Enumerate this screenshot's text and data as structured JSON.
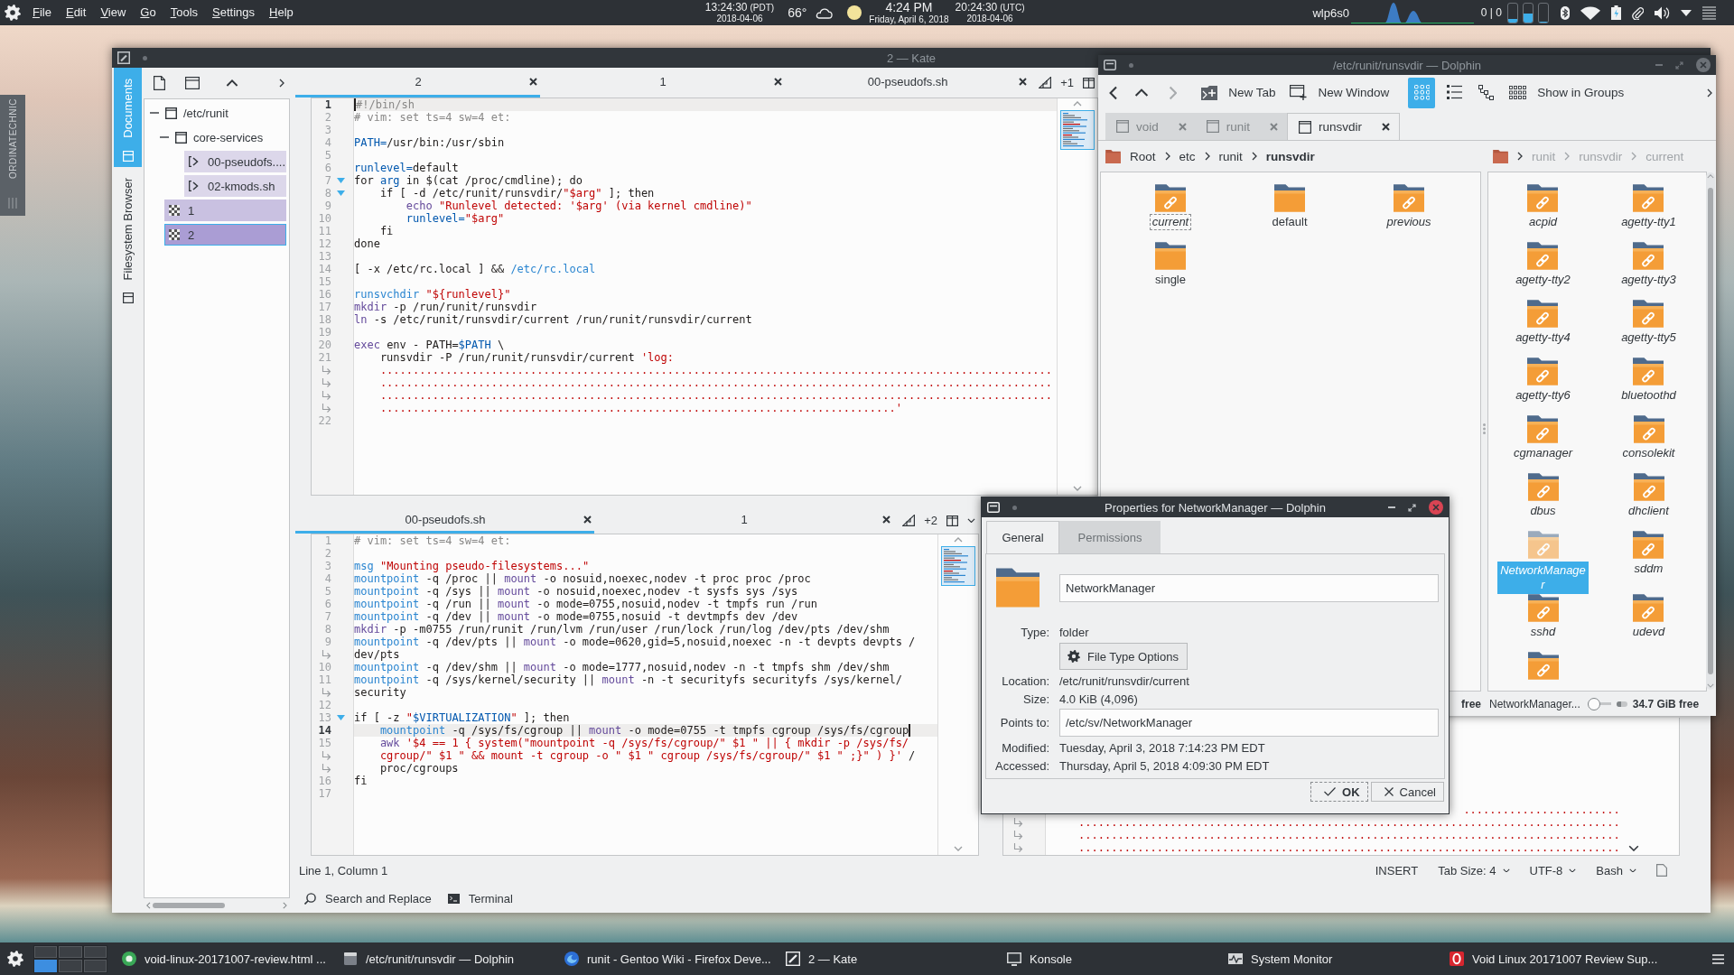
{
  "top_panel": {
    "menu": [
      "File",
      "Edit",
      "View",
      "Go",
      "Tools",
      "Settings",
      "Help"
    ],
    "local_clock": {
      "time": "13:24:30",
      "zone": "(PDT)",
      "date": "2018-04-06"
    },
    "temperature": "66°",
    "clock": {
      "time": "4:24 PM",
      "date": "Friday, April 6, 2018"
    },
    "utc_clock": {
      "time": "20:24:30",
      "zone": "(UTC)",
      "date": "2018-04-06"
    },
    "network_interface": "wlp6s0",
    "network_rate": "0 | 0",
    "load_meters": [
      {
        "level": 0.15
      },
      {
        "level": 0.45
      },
      {
        "level": 0
      }
    ]
  },
  "side_panel": {
    "label": "ORDINATECHNIC"
  },
  "kate": {
    "title": "2 — Kate",
    "side_tabs": [
      {
        "label": "Documents",
        "selected": true
      },
      {
        "label": "Filesystem Browser",
        "selected": false
      }
    ],
    "documents": [
      {
        "label": "/etc/runit",
        "kind": "folder",
        "expanded": true,
        "selected": false,
        "children": [
          {
            "label": "core-services",
            "kind": "folder",
            "expanded": true,
            "selected": false,
            "children": [
              {
                "label": "00-pseudofs....",
                "kind": "script",
                "selected": false,
                "color": "#dcd7ea"
              },
              {
                "label": "02-kmods.sh",
                "kind": "script",
                "selected": false,
                "color": "#dcd7ea"
              }
            ]
          }
        ]
      },
      {
        "label": "1",
        "kind": "untitled",
        "selected": false,
        "color": "#c9c1e1"
      },
      {
        "label": "2",
        "kind": "untitled",
        "selected": true,
        "color": "#aa9dd4"
      }
    ],
    "views": [
      {
        "tabs": [
          {
            "label": "2",
            "selected": true
          },
          {
            "label": "1",
            "selected": false
          },
          {
            "label": "00-pseudofs.sh",
            "selected": false
          }
        ],
        "more": "+1",
        "cursor_at_end": false,
        "lines": [
          {
            "number": "1",
            "current": true,
            "fold": false,
            "segments": [
              {
                "kind": "comment",
                "text": "#!/bin/sh"
              }
            ]
          },
          {
            "number": "2",
            "current": false,
            "fold": false,
            "segments": [
              {
                "kind": "comment",
                "text": "# vim: set ts=4 sw=4 et:"
              }
            ]
          },
          {
            "number": "3",
            "current": false,
            "fold": false
          },
          {
            "number": "4",
            "current": false,
            "fold": false,
            "segments": [
              {
                "kind": "variable",
                "text": "PATH="
              },
              {
                "kind": "plain",
                "text": "/usr/bin:/usr/sbin"
              }
            ]
          },
          {
            "number": "5",
            "current": false,
            "fold": false
          },
          {
            "number": "6",
            "current": false,
            "fold": false,
            "segments": [
              {
                "kind": "variable",
                "text": "runlevel="
              },
              {
                "kind": "plain",
                "text": "default"
              }
            ]
          },
          {
            "number": "7",
            "current": false,
            "fold": true,
            "segments": [
              {
                "kind": "plain",
                "text": "for "
              },
              {
                "kind": "variable",
                "text": "arg"
              },
              {
                "kind": "plain",
                "text": " in $(cat /proc/cmdline); do"
              }
            ]
          },
          {
            "number": "8",
            "current": false,
            "fold": true,
            "segments": [
              {
                "kind": "plain",
                "text": "    if [ -d /etc/runit/runsvdir/"
              },
              {
                "kind": "string",
                "text": "\"$arg\""
              },
              {
                "kind": "plain",
                "text": " ]; then"
              }
            ]
          },
          {
            "number": "9",
            "current": false,
            "fold": false,
            "segments": [
              {
                "kind": "builtin",
                "text": "        echo"
              },
              {
                "kind": "string",
                "text": " \"Runlevel detected: '$arg' (via kernel cmdline)\""
              }
            ]
          },
          {
            "number": "10",
            "current": false,
            "fold": false,
            "segments": [
              {
                "kind": "variable",
                "text": "        runlevel="
              },
              {
                "kind": "string",
                "text": "\"$arg\""
              }
            ]
          },
          {
            "number": "11",
            "current": false,
            "fold": false,
            "segments": [
              {
                "kind": "plain",
                "text": "    fi"
              }
            ]
          },
          {
            "number": "12",
            "current": false,
            "fold": false,
            "segments": [
              {
                "kind": "plain",
                "text": "done"
              }
            ]
          },
          {
            "number": "13",
            "current": false,
            "fold": false
          },
          {
            "number": "14",
            "current": false,
            "fold": false,
            "segments": [
              {
                "kind": "plain",
                "text": "[ -x /etc/rc.local ] && "
              },
              {
                "kind": "command",
                "text": "/etc/rc.local"
              }
            ]
          },
          {
            "number": "15",
            "current": false,
            "fold": false
          },
          {
            "number": "16",
            "current": false,
            "fold": false,
            "segments": [
              {
                "kind": "command",
                "text": "runsvchdir"
              },
              {
                "kind": "string",
                "text": " \"${runlevel}\""
              }
            ]
          },
          {
            "number": "17",
            "current": false,
            "fold": false,
            "segments": [
              {
                "kind": "builtin",
                "text": "mkdir"
              },
              {
                "kind": "plain",
                "text": " -p /run/runit/runsvdir"
              }
            ]
          },
          {
            "number": "18",
            "current": false,
            "fold": false,
            "segments": [
              {
                "kind": "builtin",
                "text": "ln"
              },
              {
                "kind": "plain",
                "text": " -s /etc/runit/runsvdir/current /run/runit/runsvdir/current"
              }
            ]
          },
          {
            "number": "19",
            "current": false,
            "fold": false
          },
          {
            "number": "20",
            "current": false,
            "fold": false,
            "segments": [
              {
                "kind": "builtin",
                "text": "exec"
              },
              {
                "kind": "plain",
                "text": " env - PATH="
              },
              {
                "kind": "variable",
                "text": "$PATH"
              },
              {
                "kind": "plain",
                "text": " \\"
              }
            ]
          },
          {
            "number": "21",
            "current": false,
            "fold": false,
            "segments": [
              {
                "kind": "plain",
                "text": "    runsvdir -P /run/runit/runsvdir/current "
              },
              {
                "kind": "string",
                "text": "'log:"
              }
            ],
            "wraps": [
              {
                "segments": [
                  {
                    "kind": "string",
                    "text": "....................................................................................................................................................................................................................................................................................................................................................................................................'"
                  }
                ]
              }
            ]
          },
          {
            "number": "22",
            "current": false,
            "fold": false
          }
        ]
      },
      {
        "tabs": [
          {
            "label": "00-pseudofs.sh",
            "selected": true
          },
          {
            "label": "1",
            "selected": false
          }
        ],
        "more": "+2",
        "cursor_at_end": true,
        "lines": [
          {
            "number": "1",
            "current": false,
            "fold": false,
            "segments": [
              {
                "kind": "comment",
                "text": "# vim: set ts=4 sw=4 et:"
              }
            ]
          },
          {
            "number": "2",
            "current": false,
            "fold": false
          },
          {
            "number": "3",
            "current": false,
            "fold": false,
            "segments": [
              {
                "kind": "command",
                "text": "msg"
              },
              {
                "kind": "string",
                "text": " \"Mounting pseudo-filesystems...\""
              }
            ]
          },
          {
            "number": "4",
            "current": false,
            "fold": false,
            "segments": [
              {
                "kind": "command",
                "text": "mountpoint"
              },
              {
                "kind": "plain",
                "text": " -q /proc || "
              },
              {
                "kind": "builtin",
                "text": "mount"
              },
              {
                "kind": "plain",
                "text": " -o nosuid,noexec,nodev -t proc proc /proc"
              }
            ]
          },
          {
            "number": "5",
            "current": false,
            "fold": false,
            "segments": [
              {
                "kind": "command",
                "text": "mountpoint"
              },
              {
                "kind": "plain",
                "text": " -q /sys || "
              },
              {
                "kind": "builtin",
                "text": "mount"
              },
              {
                "kind": "plain",
                "text": " -o nosuid,noexec,nodev -t sysfs sys /sys"
              }
            ]
          },
          {
            "number": "6",
            "current": false,
            "fold": false,
            "segments": [
              {
                "kind": "command",
                "text": "mountpoint"
              },
              {
                "kind": "plain",
                "text": " -q /run || "
              },
              {
                "kind": "builtin",
                "text": "mount"
              },
              {
                "kind": "plain",
                "text": " -o mode=0755,nosuid,nodev -t tmpfs run /run"
              }
            ]
          },
          {
            "number": "7",
            "current": false,
            "fold": false,
            "segments": [
              {
                "kind": "command",
                "text": "mountpoint"
              },
              {
                "kind": "plain",
                "text": " -q /dev || "
              },
              {
                "kind": "builtin",
                "text": "mount"
              },
              {
                "kind": "plain",
                "text": " -o mode=0755,nosuid -t devtmpfs dev /dev"
              }
            ]
          },
          {
            "number": "8",
            "current": false,
            "fold": false,
            "segments": [
              {
                "kind": "builtin",
                "text": "mkdir"
              },
              {
                "kind": "plain",
                "text": " -p -m0755 /run/runit /run/lvm /run/user /run/lock /run/log /dev/pts /dev/shm"
              }
            ]
          },
          {
            "number": "9",
            "current": false,
            "fold": false,
            "segments": [
              {
                "kind": "command",
                "text": "mountpoint"
              },
              {
                "kind": "plain",
                "text": " -q /dev/pts || "
              },
              {
                "kind": "builtin",
                "text": "mount"
              },
              {
                "kind": "plain",
                "text": " -o mode=0620,gid=5,nosuid,noexec -n -t devpts devpts /"
              }
            ],
            "wraps": [
              {
                "segments": [
                  {
                    "kind": "plain",
                    "text": "dev/pts"
                  }
                ]
              }
            ]
          },
          {
            "number": "10",
            "current": false,
            "fold": false,
            "segments": [
              {
                "kind": "command",
                "text": "mountpoint"
              },
              {
                "kind": "plain",
                "text": " -q /dev/shm || "
              },
              {
                "kind": "builtin",
                "text": "mount"
              },
              {
                "kind": "plain",
                "text": " -o mode=1777,nosuid,nodev -n -t tmpfs shm /dev/shm"
              }
            ]
          },
          {
            "number": "11",
            "current": false,
            "fold": false,
            "segments": [
              {
                "kind": "command",
                "text": "mountpoint"
              },
              {
                "kind": "plain",
                "text": " -q /sys/kernel/security || "
              },
              {
                "kind": "builtin",
                "text": "mount"
              },
              {
                "kind": "plain",
                "text": " -n -t securityfs securityfs /sys/kernel/"
              }
            ],
            "wraps": [
              {
                "segments": [
                  {
                    "kind": "plain",
                    "text": "security"
                  }
                ]
              }
            ]
          },
          {
            "number": "12",
            "current": false,
            "fold": false
          },
          {
            "number": "13",
            "current": false,
            "fold": true,
            "segments": [
              {
                "kind": "plain",
                "text": "if [ -z "
              },
              {
                "kind": "string",
                "text": "\""
              },
              {
                "kind": "variable",
                "text": "$VIRTUALIZATION"
              },
              {
                "kind": "string",
                "text": "\""
              },
              {
                "kind": "plain",
                "text": " ]; then"
              }
            ]
          },
          {
            "number": "14",
            "current": true,
            "fold": false,
            "segments": [
              {
                "kind": "command",
                "text": "    mountpoint"
              },
              {
                "kind": "plain",
                "text": " -q /sys/fs/cgroup || "
              },
              {
                "kind": "builtin",
                "text": "mount"
              },
              {
                "kind": "plain",
                "text": " -o mode=0755 -t tmpfs cgroup /sys/fs/cgroup"
              }
            ]
          },
          {
            "number": "15",
            "current": false,
            "fold": false,
            "segments": [
              {
                "kind": "builtin",
                "text": "    awk"
              },
              {
                "kind": "string",
                "text": " '$4 == 1 { system(\"mountpoint -q /sys/fs/cgroup/\" $1 \" || { mkdir -p /sys/fs/"
              }
            ],
            "wraps": [
              {
                "segments": [
                  {
                    "kind": "string",
                    "text": "cgroup/\" $1 \" && mount -t cgroup -o \" $1 \" cgroup /sys/fs/cgroup/\" $1 \" ;}\" ) }'"
                  },
                  {
                    "kind": "plain",
                    "text": " /"
                  }
                ]
              },
              {
                "segments": [
                  {
                    "kind": "plain",
                    "text": "proc/cgroups"
                  }
                ]
              }
            ]
          },
          {
            "number": "16",
            "current": false,
            "fold": false,
            "segments": [
              {
                "kind": "plain",
                "text": "fi"
              }
            ]
          },
          {
            "number": "17",
            "current": false,
            "fold": false
          }
        ]
      }
    ],
    "third_view": {
      "wrap_rows": [
        {
          "segments": [
            {
              "kind": "string",
              "text": "........................"
            }
          ]
        },
        {
          "segments": [
            {
              "kind": "string",
              "text": "..................................................................................."
            }
          ]
        },
        {
          "segments": [
            {
              "kind": "string",
              "text": "..................................................................................."
            }
          ]
        },
        {
          "segments": [
            {
              "kind": "string",
              "text": "..................................................................................."
            }
          ]
        }
      ]
    },
    "status": {
      "position": "Line 1, Column 1",
      "mode": "INSERT",
      "menus": [
        "Tab Size: 4",
        "UTF-8",
        "Bash"
      ]
    },
    "tools": [
      {
        "label": "Search and Replace",
        "kind": "search"
      },
      {
        "label": "Terminal",
        "kind": "terminal"
      }
    ]
  },
  "dolphin": {
    "title": "/etc/runit/runsvdir — Dolphin",
    "toolbar": {
      "new_tab": "New Tab",
      "new_window": "New Window",
      "view_modes": [
        {
          "kind": "icons",
          "selected": true
        },
        {
          "kind": "compact",
          "selected": false
        },
        {
          "kind": "details",
          "selected": false
        }
      ],
      "groups": "Show in Groups"
    },
    "tabs": [
      {
        "label": "void",
        "selected": false
      },
      {
        "label": "runit",
        "selected": false
      },
      {
        "label": "runsvdir",
        "selected": true
      }
    ],
    "panes": [
      {
        "active": true,
        "collapsed": false,
        "breadcrumb": [
          "Root",
          "etc",
          "runit",
          "runsvdir"
        ],
        "items": [
          {
            "label": "current",
            "symlink": true,
            "selected": false,
            "focused": true
          },
          {
            "label": "default",
            "symlink": false,
            "selected": false,
            "focused": false
          },
          {
            "label": "previous",
            "symlink": true,
            "selected": false,
            "focused": false
          },
          {
            "label": "single",
            "symlink": false,
            "selected": false,
            "focused": false
          }
        ],
        "status": {
          "free_space": "free"
        }
      },
      {
        "active": false,
        "collapsed": true,
        "breadcrumb": [
          "runit",
          "runsvdir",
          "current"
        ],
        "items": [
          {
            "label": "acpid",
            "symlink": true,
            "selected": false,
            "focused": false
          },
          {
            "label": "agetty-tty1",
            "symlink": true,
            "selected": false,
            "focused": false
          },
          {
            "label": "agetty-tty2",
            "symlink": true,
            "selected": false,
            "focused": false
          },
          {
            "label": "agetty-tty3",
            "symlink": true,
            "selected": false,
            "focused": false
          },
          {
            "label": "agetty-tty4",
            "symlink": true,
            "selected": false,
            "focused": false
          },
          {
            "label": "agetty-tty5",
            "symlink": true,
            "selected": false,
            "focused": false
          },
          {
            "label": "agetty-tty6",
            "symlink": true,
            "selected": false,
            "focused": false
          },
          {
            "label": "bluetoothd",
            "symlink": true,
            "selected": false,
            "focused": false
          },
          {
            "label": "cgmanager",
            "symlink": true,
            "selected": false,
            "focused": false
          },
          {
            "label": "consolekit",
            "symlink": true,
            "selected": false,
            "focused": false
          },
          {
            "label": "dbus",
            "symlink": true,
            "selected": false,
            "focused": false
          },
          {
            "label": "dhclient",
            "symlink": true,
            "selected": false,
            "focused": false
          },
          {
            "label": "NetworkManager",
            "symlink": true,
            "selected": true,
            "focused": false
          },
          {
            "label": "sddm",
            "symlink": true,
            "selected": false,
            "focused": false
          },
          {
            "label": "sshd",
            "symlink": true,
            "selected": false,
            "focused": false
          },
          {
            "label": "udevd",
            "symlink": true,
            "selected": false,
            "focused": false
          },
          {
            "symlink": true,
            "selected": false,
            "focused": false
          }
        ],
        "status": {
          "selection": "NetworkManager...",
          "zoom": {
            "level": 0
          },
          "space": {
            "level": 0.4
          },
          "free_space": "34.7 GiB free"
        }
      }
    ]
  },
  "properties": {
    "title": "Properties for NetworkManager — Dolphin",
    "tabs": [
      {
        "label": "General",
        "selected": true
      },
      {
        "label": "Permissions",
        "selected": false
      }
    ],
    "name": "NetworkManager",
    "rows": [
      {
        "kind": "text",
        "label": "Type:",
        "value": "folder"
      },
      {
        "kind": "button",
        "value": "File Type Options"
      },
      {
        "kind": "text",
        "label": "Location:",
        "value": "/etc/runit/runsvdir/current"
      },
      {
        "kind": "text",
        "label": "Size:",
        "value": "4.0 KiB (4,096)"
      },
      {
        "kind": "field",
        "label": "Points to:",
        "value": "/etc/sv/NetworkManager"
      },
      {
        "kind": "text",
        "label": "Modified:",
        "value": "Tuesday, April 3, 2018 7:14:23 PM EDT"
      },
      {
        "kind": "text",
        "label": "Accessed:",
        "value": "Thursday, April 5, 2018 4:09:30 PM EDT"
      }
    ],
    "buttons": [
      {
        "label": "OK",
        "kind": "ok",
        "focused": true
      },
      {
        "label": "Cancel",
        "kind": "cancel",
        "focused": false
      }
    ]
  },
  "taskbar": {
    "desktops": [
      {
        "selected": false
      },
      {
        "selected": false
      },
      {
        "selected": false
      },
      {
        "selected": true
      },
      {
        "selected": false
      },
      {
        "selected": false
      }
    ],
    "tasks": [
      {
        "label": "void-linux-20171007-review.html ...",
        "kind": "disc",
        "selected": false
      },
      {
        "label": "/etc/runit/runsvdir — Dolphin",
        "kind": "window",
        "selected": false
      },
      {
        "label": "runit - Gentoo Wiki - Firefox Deve...",
        "kind": "globe",
        "selected": false
      },
      {
        "label": "2 — Kate",
        "kind": "pencil",
        "selected": false
      },
      {
        "label": "Konsole",
        "kind": "terminal",
        "selected": false
      },
      {
        "label": "System Monitor",
        "kind": "chart",
        "selected": false
      },
      {
        "label": "Void Linux 20171007 Review Sup...",
        "kind": "ring",
        "selected": false
      }
    ]
  }
}
